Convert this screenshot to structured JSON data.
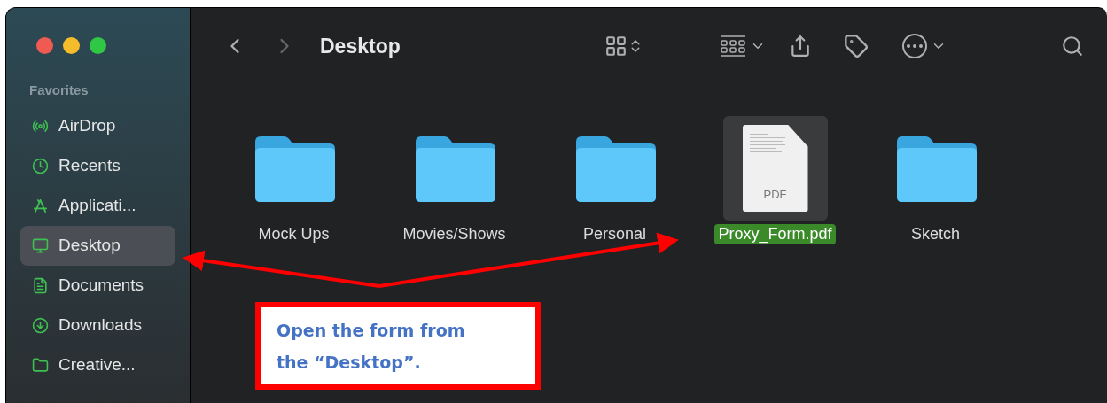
{
  "window": {
    "title": "Desktop"
  },
  "sidebar": {
    "section": "Favorites",
    "items": [
      {
        "label": "AirDrop",
        "kind": "airdrop",
        "selected": false
      },
      {
        "label": "Recents",
        "kind": "clock",
        "selected": false
      },
      {
        "label": "Applicati...",
        "kind": "apps",
        "selected": false
      },
      {
        "label": "Desktop",
        "kind": "desktop",
        "selected": true
      },
      {
        "label": "Documents",
        "kind": "document",
        "selected": false
      },
      {
        "label": "Downloads",
        "kind": "download",
        "selected": false
      },
      {
        "label": "Creative...",
        "kind": "folder",
        "selected": false
      }
    ]
  },
  "files": [
    {
      "name": "Mock Ups",
      "kind": "folder",
      "selected": false
    },
    {
      "name": "Movies/Shows",
      "kind": "folder",
      "selected": false
    },
    {
      "name": "Personal",
      "kind": "folder",
      "selected": false
    },
    {
      "name": "Proxy_Form.pdf",
      "kind": "pdf",
      "selected": true,
      "thumbnail_label": "PDF"
    },
    {
      "name": "Sketch",
      "kind": "folder",
      "selected": false
    }
  ],
  "callout": {
    "lines": [
      "Open the form from",
      "the “Desktop”."
    ]
  }
}
